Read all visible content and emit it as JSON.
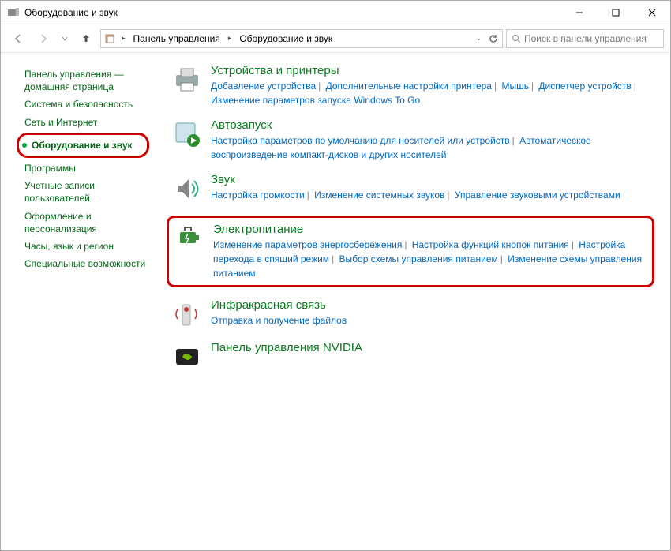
{
  "titlebar": {
    "title": "Оборудование и звук"
  },
  "breadcrumb": {
    "root": "Панель управления",
    "current": "Оборудование и звук"
  },
  "search": {
    "placeholder": "Поиск в панели управления"
  },
  "sidebar": {
    "items": [
      {
        "label": "Панель управления — домашняя страница"
      },
      {
        "label": "Система и безопасность"
      },
      {
        "label": "Сеть и Интернет"
      },
      {
        "label": "Оборудование и звук"
      },
      {
        "label": "Программы"
      },
      {
        "label": "Учетные записи пользователей"
      },
      {
        "label": "Оформление и персонализация"
      },
      {
        "label": "Часы, язык и регион"
      },
      {
        "label": "Специальные возможности"
      }
    ]
  },
  "categories": [
    {
      "title": "Устройства и принтеры",
      "links": [
        "Добавление устройства",
        "Дополнительные настройки принтера",
        "Мышь",
        "Диспетчер устройств",
        "Изменение параметров запуска Windows To Go"
      ]
    },
    {
      "title": "Автозапуск",
      "links": [
        "Настройка параметров по умолчанию для носителей или устройств",
        "Автоматическое воспроизведение компакт-дисков и других носителей"
      ]
    },
    {
      "title": "Звук",
      "links": [
        "Настройка громкости",
        "Изменение системных звуков",
        "Управление звуковыми устройствами"
      ]
    },
    {
      "title": "Электропитание",
      "links": [
        "Изменение параметров энергосбережения",
        "Настройка функций кнопок питания",
        "Настройка перехода в спящий режим",
        "Выбор схемы управления питанием",
        "Изменение схемы управления питанием"
      ]
    },
    {
      "title": "Инфракрасная связь",
      "links": [
        "Отправка и получение файлов"
      ]
    },
    {
      "title": "Панель управления NVIDIA",
      "links": []
    }
  ]
}
